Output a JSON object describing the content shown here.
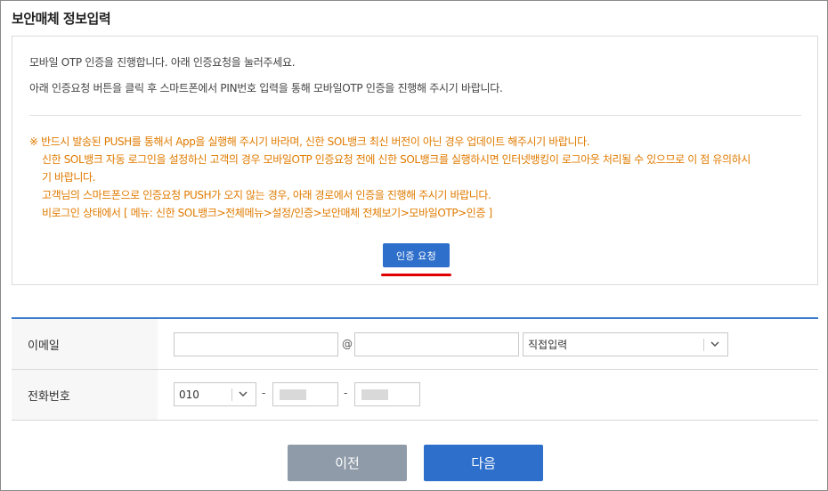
{
  "page": {
    "title": "보안매체 정보입력"
  },
  "info": {
    "line1": "모바일 OTP 인증을 진행합니다. 아래 인증요청을 눌러주세요.",
    "line2": "아래 인증요청 버튼을 클릭 후 스마트폰에서 PIN번호 입력을 통해 모바일OTP 인증을 진행해 주시기 바랍니다.",
    "notice": [
      "※ 반드시 발송된 PUSH를 통해서 App을 실행해 주시기 바라며, 신한 SOL뱅크 최신 버전이 아닌 경우 업데이트 해주시기 바랍니다.",
      "신한 SOL뱅크 자동 로그인을 설정하신 고객의 경우 모바일OTP 인증요청 전에 신한 SOL뱅크를 실행하시면 인터넷뱅킹이 로그아웃 처리될 수 있으므로 이 점 유의하시",
      "기 바랍니다.",
      "고객님의 스마트폰으로 인증요청 PUSH가 오지 않는 경우, 아래 경로에서 인증을 진행해 주시기 바랍니다.",
      "비로그인 상태에서 [ 메뉴: 신한 SOL뱅크>전체메뉴>설정/인증>보안매체 전체보기>모바일OTP>인증 ]"
    ],
    "auth_button": "인증 요청"
  },
  "form": {
    "email_label": "이메일",
    "email_id_value": "",
    "at_symbol": "@",
    "email_domain_value": "",
    "email_domain_select": "직접입력",
    "phone_label": "전화번호",
    "phone_prefix_select": "010",
    "dash": "-"
  },
  "actions": {
    "prev": "이전",
    "next": "다음"
  },
  "icons": {
    "chevron": "chevron-down-icon"
  },
  "colors": {
    "primary": "#2d6fcb",
    "notice": "#e07b00",
    "highlight": "#e00000",
    "secondary_button": "#8f9ba8"
  }
}
